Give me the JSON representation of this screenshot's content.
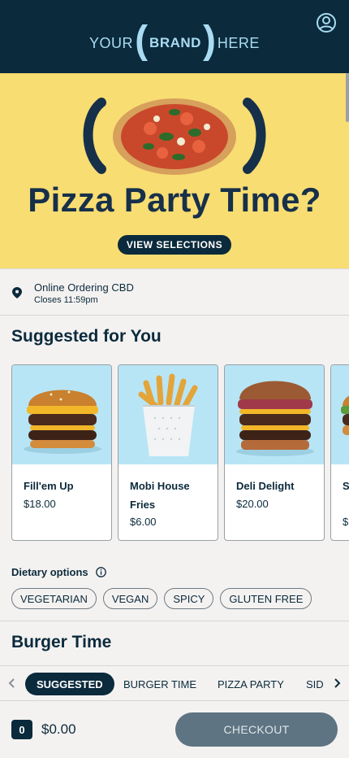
{
  "header": {
    "logo": {
      "left": "YOUR",
      "brand": "BRAND",
      "right": "HERE",
      "paren_open": "(",
      "paren_close": ")"
    },
    "account_icon": "user-circle-icon"
  },
  "hero": {
    "title": "Pizza Party Time?",
    "button_label": "VIEW SELECTIONS",
    "image": "pizza-icon"
  },
  "location": {
    "icon": "map-pin-icon",
    "name": "Online Ordering CBD",
    "hours": "Closes 11:59pm"
  },
  "suggested": {
    "title": "Suggested for You",
    "items": [
      {
        "name": "Fill'em Up",
        "price": "$18.00",
        "image": "burger-icon"
      },
      {
        "name": "Mobi House Fries",
        "price": "$6.00",
        "image": "fries-icon"
      },
      {
        "name": "Deli Delight",
        "price": "$20.00",
        "image": "deli-burger-icon"
      },
      {
        "name": "S V",
        "price": "$",
        "image": "burger-icon"
      }
    ]
  },
  "dietary": {
    "label": "Dietary options",
    "info_icon": "info-icon",
    "options": [
      "VEGETARIAN",
      "VEGAN",
      "SPICY",
      "GLUTEN FREE"
    ]
  },
  "category": {
    "title": "Burger Time"
  },
  "tabs": {
    "items": [
      "SUGGESTED",
      "BURGER TIME",
      "PIZZA PARTY",
      "SID"
    ],
    "active": "SUGGESTED",
    "prev_icon": "chevron-left-icon",
    "next_icon": "chevron-right-icon"
  },
  "cart": {
    "count": "0",
    "total": "$0.00",
    "checkout_label": "CHECKOUT"
  },
  "colors": {
    "navy": "#0b2a3c",
    "hero_yellow": "#f8dd72",
    "logo_blue": "#a9dcf2",
    "card_image_bg": "#b8e5f6",
    "checkout_disabled": "#5f7482"
  }
}
